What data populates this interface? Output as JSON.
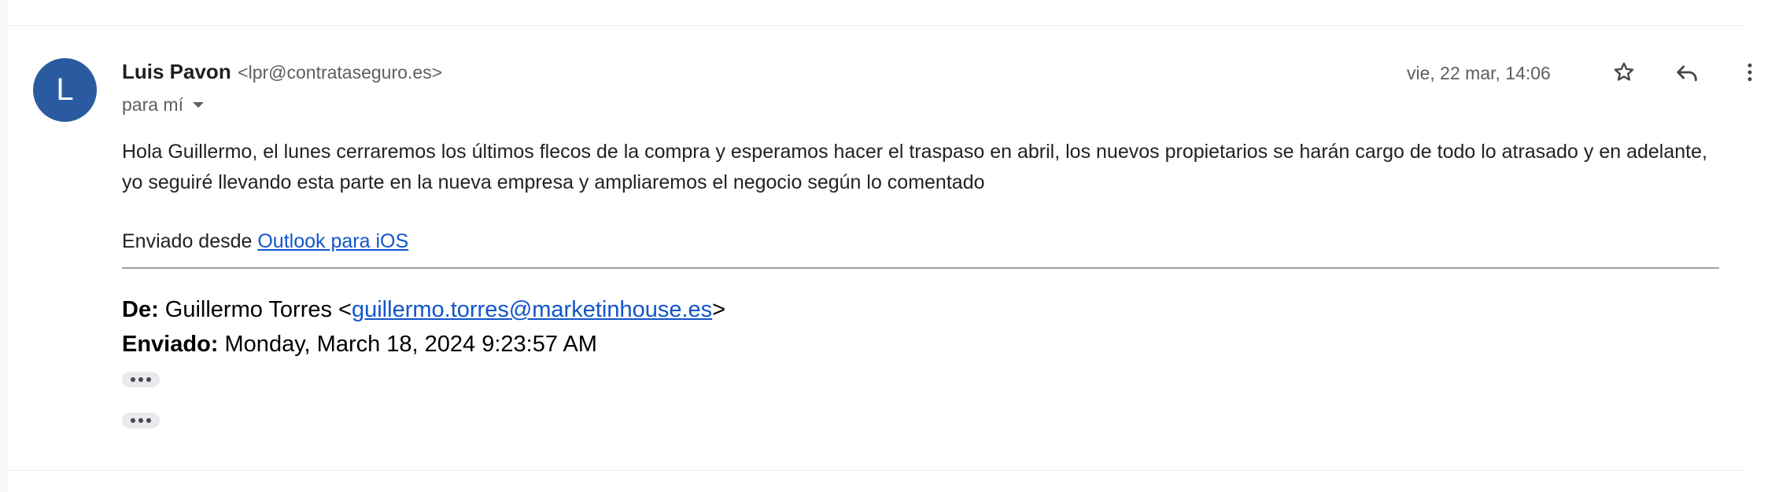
{
  "message": {
    "avatar_letter": "L",
    "sender_name": "Luis Pavon",
    "sender_email": "<lpr@contrataseguro.es>",
    "recipient_label": "para mí",
    "date": "vie, 22 mar, 14:06",
    "body": "Hola Guillermo, el lunes cerraremos los últimos flecos de la compra y esperamos hacer el traspaso en abril, los nuevos propietarios se harán cargo de todo lo atrasado y en adelante, yo seguiré llevando esta parte en la nueva empresa y ampliaremos el negocio según lo comentado",
    "sent_from_prefix": "Enviado desde ",
    "sent_from_link": "Outlook para iOS"
  },
  "actions": {
    "star_icon": "star-icon",
    "reply_icon": "reply-icon",
    "more_icon": "more-vert-icon"
  },
  "quoted": {
    "from_label": "De:",
    "from_name": " Guillermo Torres <",
    "from_email": "guillermo.torres@marketinhouse.es",
    "from_close": ">",
    "sent_label": "Enviado:",
    "sent_value": " Monday, March 18, 2024 9:23:57 AM"
  },
  "colors": {
    "avatar_bg": "#2a5ba0",
    "link": "#1155cc"
  }
}
